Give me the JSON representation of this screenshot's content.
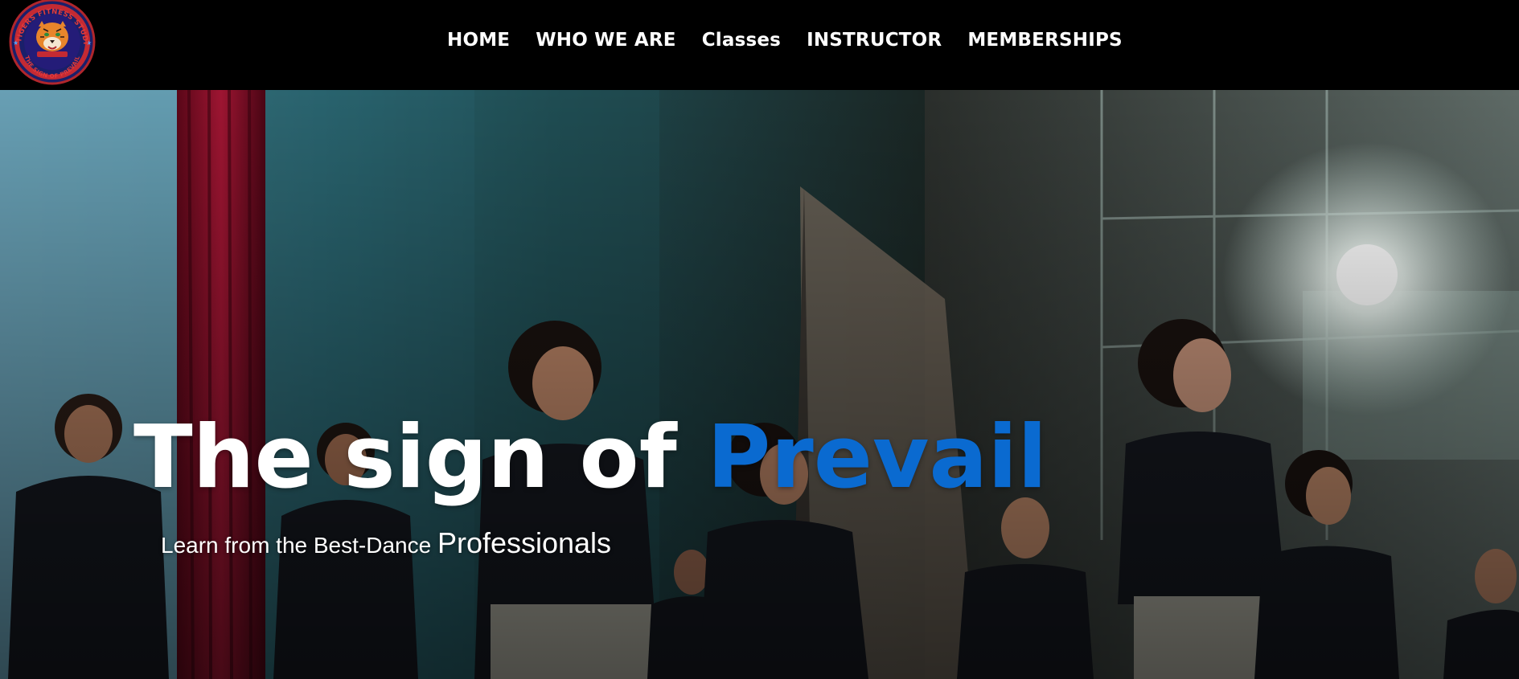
{
  "header": {
    "logo": {
      "ring_text_top": "X TIGERS FITNESS STUDIO",
      "ring_text_bottom": "THE SIGN OF PREVAIL",
      "icon": "tiger-logo-icon"
    },
    "nav": [
      {
        "label": "HOME"
      },
      {
        "label": "WHO WE ARE"
      },
      {
        "label": "Classes"
      },
      {
        "label": "INSTRUCTOR"
      },
      {
        "label": "MEMBERSHIPS"
      }
    ]
  },
  "hero": {
    "headline_prefix": "The sign of ",
    "headline_accent": "Prevail",
    "subline_part1": "Learn from the Best-Dance ",
    "subline_part2": "Professionals"
  },
  "colors": {
    "header_bg": "#000000",
    "accent_blue": "#0a6ad0",
    "text_white": "#ffffff"
  }
}
